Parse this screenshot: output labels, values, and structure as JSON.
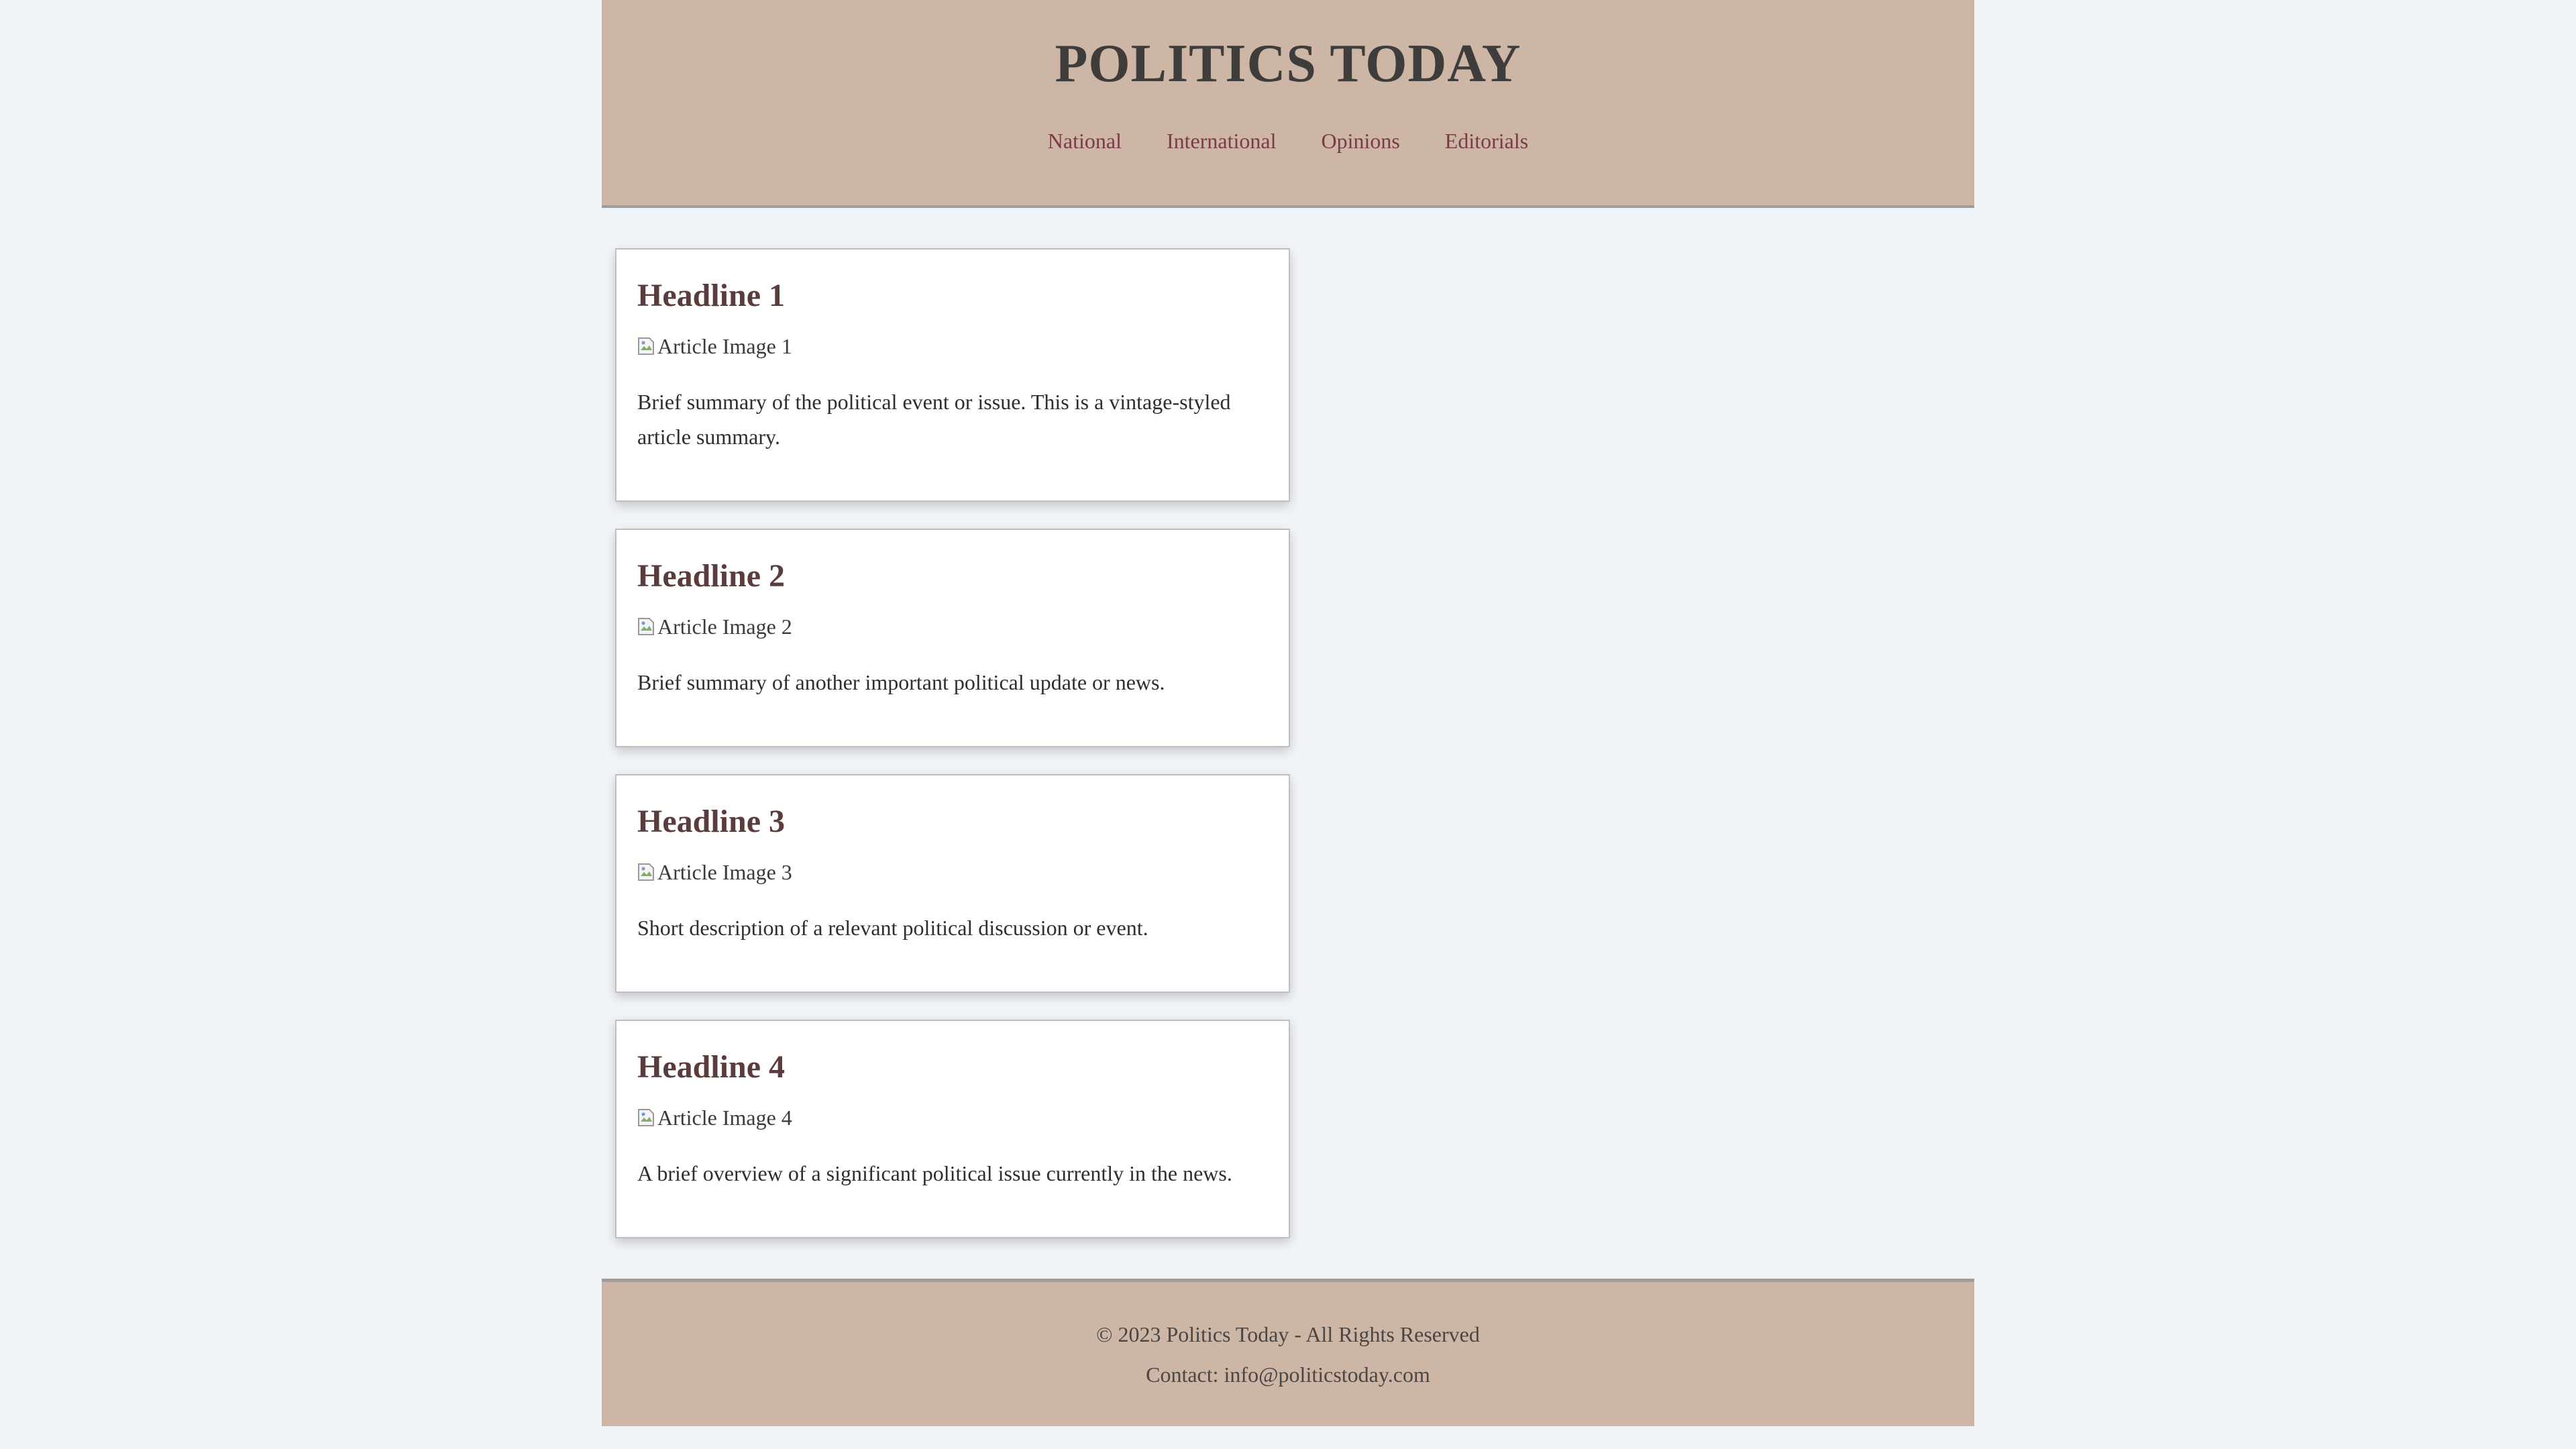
{
  "header": {
    "title": "POLITICS TODAY",
    "nav": [
      {
        "label": "National"
      },
      {
        "label": "International"
      },
      {
        "label": "Opinions"
      },
      {
        "label": "Editorials"
      }
    ]
  },
  "articles": [
    {
      "headline": "Headline 1",
      "image_alt": "Article Image 1",
      "summary": "Brief summary of the political event or issue. This is a vintage-styled article summary."
    },
    {
      "headline": "Headline 2",
      "image_alt": "Article Image 2",
      "summary": "Brief summary of another important political update or news."
    },
    {
      "headline": "Headline 3",
      "image_alt": "Article Image 3",
      "summary": "Short description of a relevant political discussion or event."
    },
    {
      "headline": "Headline 4",
      "image_alt": "Article Image 4",
      "summary": "A brief overview of a significant political issue currently in the news."
    }
  ],
  "footer": {
    "copyright": "© 2023 Politics Today - All Rights Reserved",
    "contact": "Contact: info@politicstoday.com"
  },
  "colors": {
    "background": "#f0f3f8",
    "header_bg": "#cdb6a5",
    "nav_link": "#7a3b46",
    "headline": "#5b3c3c"
  },
  "icons": {
    "article_image": "broken-image-icon"
  }
}
